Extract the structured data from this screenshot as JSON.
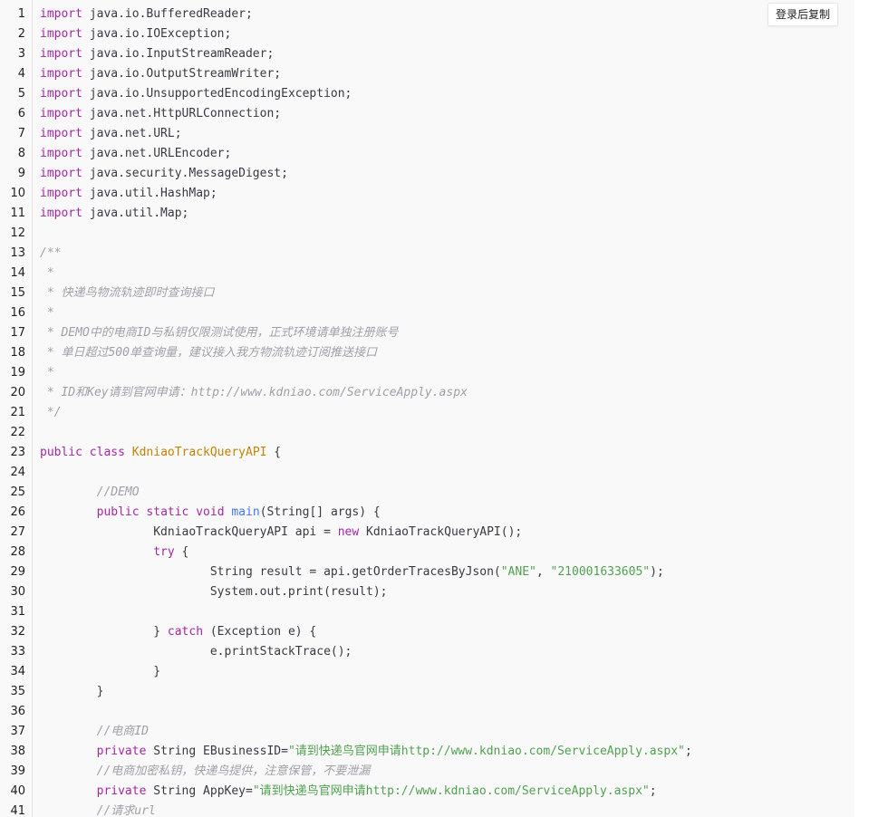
{
  "copy_button": {
    "label": "登录后复制"
  },
  "lines": [
    {
      "num": "1",
      "tokens": [
        {
          "t": "import",
          "c": "kw"
        },
        {
          "t": " java.io.BufferedReader;",
          "c": ""
        }
      ]
    },
    {
      "num": "2",
      "tokens": [
        {
          "t": "import",
          "c": "kw"
        },
        {
          "t": " java.io.IOException;",
          "c": ""
        }
      ]
    },
    {
      "num": "3",
      "tokens": [
        {
          "t": "import",
          "c": "kw"
        },
        {
          "t": " java.io.InputStreamReader;",
          "c": ""
        }
      ]
    },
    {
      "num": "4",
      "tokens": [
        {
          "t": "import",
          "c": "kw"
        },
        {
          "t": " java.io.OutputStreamWriter;",
          "c": ""
        }
      ]
    },
    {
      "num": "5",
      "tokens": [
        {
          "t": "import",
          "c": "kw"
        },
        {
          "t": " java.io.UnsupportedEncodingException;",
          "c": ""
        }
      ]
    },
    {
      "num": "6",
      "tokens": [
        {
          "t": "import",
          "c": "kw"
        },
        {
          "t": " java.net.HttpURLConnection;",
          "c": ""
        }
      ]
    },
    {
      "num": "7",
      "tokens": [
        {
          "t": "import",
          "c": "kw"
        },
        {
          "t": " java.net.URL;",
          "c": ""
        }
      ]
    },
    {
      "num": "8",
      "tokens": [
        {
          "t": "import",
          "c": "kw"
        },
        {
          "t": " java.net.URLEncoder;",
          "c": ""
        }
      ]
    },
    {
      "num": "9",
      "tokens": [
        {
          "t": "import",
          "c": "kw"
        },
        {
          "t": " java.security.MessageDigest;",
          "c": ""
        }
      ]
    },
    {
      "num": "10",
      "tokens": [
        {
          "t": "import",
          "c": "kw"
        },
        {
          "t": " java.util.HashMap;",
          "c": ""
        }
      ]
    },
    {
      "num": "11",
      "tokens": [
        {
          "t": "import",
          "c": "kw"
        },
        {
          "t": " java.util.Map;",
          "c": ""
        }
      ]
    },
    {
      "num": "12",
      "tokens": []
    },
    {
      "num": "13",
      "tokens": [
        {
          "t": "/**",
          "c": "cm"
        }
      ]
    },
    {
      "num": "14",
      "tokens": [
        {
          "t": " *",
          "c": "cm"
        }
      ]
    },
    {
      "num": "15",
      "tokens": [
        {
          "t": " * 快递鸟物流轨迹即时查询接口",
          "c": "cm"
        }
      ]
    },
    {
      "num": "16",
      "tokens": [
        {
          "t": " *",
          "c": "cm"
        }
      ]
    },
    {
      "num": "17",
      "tokens": [
        {
          "t": " * DEMO中的电商ID与私钥仅限测试使用，正式环境请单独注册账号",
          "c": "cm"
        }
      ]
    },
    {
      "num": "18",
      "tokens": [
        {
          "t": " * 单日超过500单查询量，建议接入我方物流轨迹订阅推送接口",
          "c": "cm"
        }
      ]
    },
    {
      "num": "19",
      "tokens": [
        {
          "t": " *",
          "c": "cm"
        }
      ]
    },
    {
      "num": "20",
      "tokens": [
        {
          "t": " * ID和Key请到官网申请：http://www.kdniao.com/ServiceApply.aspx",
          "c": "cm"
        }
      ]
    },
    {
      "num": "21",
      "tokens": [
        {
          "t": " */",
          "c": "cm"
        }
      ]
    },
    {
      "num": "22",
      "tokens": []
    },
    {
      "num": "23",
      "tokens": [
        {
          "t": "public",
          "c": "kw"
        },
        {
          "t": " ",
          "c": ""
        },
        {
          "t": "class",
          "c": "kw"
        },
        {
          "t": " ",
          "c": ""
        },
        {
          "t": "KdniaoTrackQueryAPI",
          "c": "title"
        },
        {
          "t": " {",
          "c": ""
        }
      ]
    },
    {
      "num": "24",
      "tokens": []
    },
    {
      "num": "25",
      "tokens": [
        {
          "t": "        ",
          "c": ""
        },
        {
          "t": "//DEMO",
          "c": "cm"
        }
      ]
    },
    {
      "num": "26",
      "tokens": [
        {
          "t": "        ",
          "c": ""
        },
        {
          "t": "public",
          "c": "kw"
        },
        {
          "t": " ",
          "c": ""
        },
        {
          "t": "static",
          "c": "kw"
        },
        {
          "t": " ",
          "c": ""
        },
        {
          "t": "void",
          "c": "kw"
        },
        {
          "t": " ",
          "c": ""
        },
        {
          "t": "main",
          "c": "fn"
        },
        {
          "t": "(String[] args) {",
          "c": ""
        }
      ]
    },
    {
      "num": "27",
      "tokens": [
        {
          "t": "                KdniaoTrackQueryAPI api = ",
          "c": ""
        },
        {
          "t": "new",
          "c": "kw"
        },
        {
          "t": " KdniaoTrackQueryAPI();",
          "c": ""
        }
      ]
    },
    {
      "num": "28",
      "tokens": [
        {
          "t": "                ",
          "c": ""
        },
        {
          "t": "try",
          "c": "kw"
        },
        {
          "t": " {",
          "c": ""
        }
      ]
    },
    {
      "num": "29",
      "tokens": [
        {
          "t": "                        String result = api.getOrderTracesByJson(",
          "c": ""
        },
        {
          "t": "\"ANE\"",
          "c": "str"
        },
        {
          "t": ", ",
          "c": ""
        },
        {
          "t": "\"210001633605\"",
          "c": "str"
        },
        {
          "t": ");",
          "c": ""
        }
      ]
    },
    {
      "num": "30",
      "tokens": [
        {
          "t": "                        System.out.print(result);",
          "c": ""
        }
      ]
    },
    {
      "num": "31",
      "tokens": []
    },
    {
      "num": "32",
      "tokens": [
        {
          "t": "                } ",
          "c": ""
        },
        {
          "t": "catch",
          "c": "kw"
        },
        {
          "t": " (Exception e) {",
          "c": ""
        }
      ]
    },
    {
      "num": "33",
      "tokens": [
        {
          "t": "                        e.printStackTrace();",
          "c": ""
        }
      ]
    },
    {
      "num": "34",
      "tokens": [
        {
          "t": "                }",
          "c": ""
        }
      ]
    },
    {
      "num": "35",
      "tokens": [
        {
          "t": "        }",
          "c": ""
        }
      ]
    },
    {
      "num": "36",
      "tokens": []
    },
    {
      "num": "37",
      "tokens": [
        {
          "t": "        ",
          "c": ""
        },
        {
          "t": "//电商ID",
          "c": "cm"
        }
      ]
    },
    {
      "num": "38",
      "tokens": [
        {
          "t": "        ",
          "c": ""
        },
        {
          "t": "private",
          "c": "kw"
        },
        {
          "t": " String EBusinessID=",
          "c": ""
        },
        {
          "t": "\"请到快递鸟官网申请http://www.kdniao.com/ServiceApply.aspx\"",
          "c": "str"
        },
        {
          "t": ";",
          "c": ""
        }
      ]
    },
    {
      "num": "39",
      "tokens": [
        {
          "t": "        ",
          "c": ""
        },
        {
          "t": "//电商加密私钥，快递鸟提供，注意保管，不要泄漏",
          "c": "cm"
        }
      ]
    },
    {
      "num": "40",
      "tokens": [
        {
          "t": "        ",
          "c": ""
        },
        {
          "t": "private",
          "c": "kw"
        },
        {
          "t": " String AppKey=",
          "c": ""
        },
        {
          "t": "\"请到快递鸟官网申请http://www.kdniao.com/ServiceApply.aspx\"",
          "c": "str"
        },
        {
          "t": ";",
          "c": ""
        }
      ]
    },
    {
      "num": "41",
      "tokens": [
        {
          "t": "        ",
          "c": ""
        },
        {
          "t": "//请求url",
          "c": "cm"
        }
      ]
    }
  ]
}
